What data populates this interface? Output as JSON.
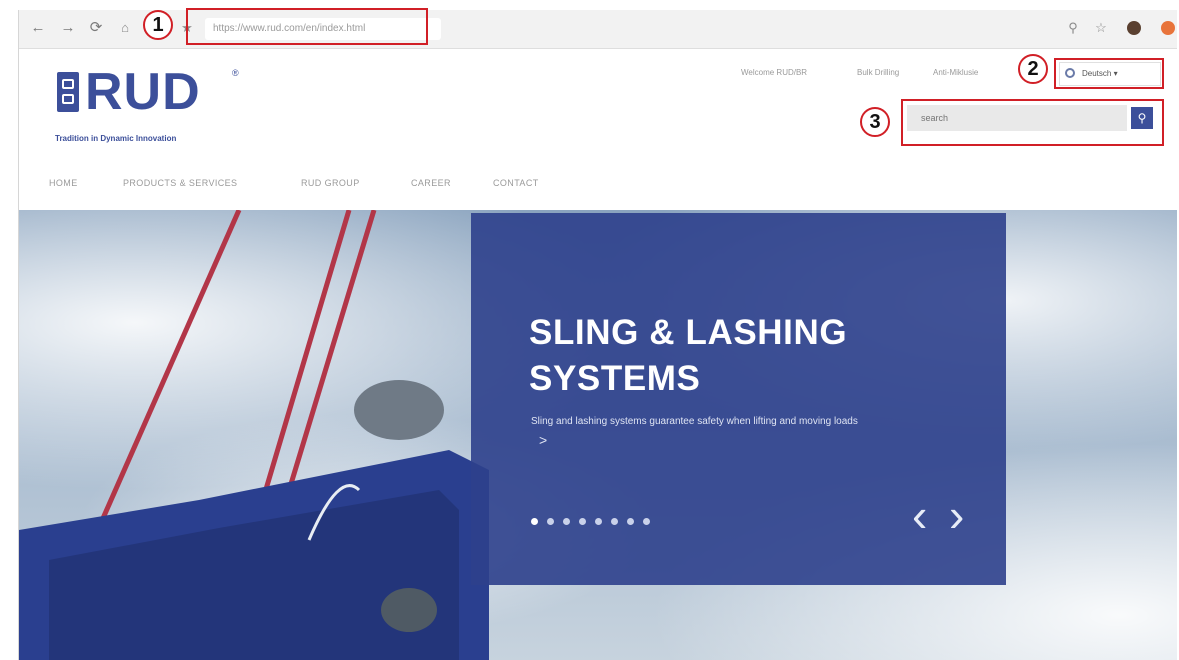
{
  "browser": {
    "back_glyph": "←",
    "forward_glyph": "→",
    "reload_glyph": "⟳",
    "url": "https://www.rud.com/en/index.html"
  },
  "header": {
    "logo_text": "RUD",
    "logo_reg": "®",
    "tagline": "Tradition in Dynamic Innovation",
    "top_links": [
      "Welcome RUD/BR",
      "Bulk Drilling",
      "Anti-Miklusie"
    ],
    "language_label": "Deutsch",
    "search_placeholder": "search"
  },
  "nav": {
    "items": [
      "HOME",
      "PRODUCTS & SERVICES",
      "RUD GROUP",
      "CAREER",
      "CONTACT"
    ]
  },
  "hero": {
    "headline_line1": "SLING & LASHING",
    "headline_line2": "SYSTEMS",
    "subtext": "Sling and lashing systems guarantee safety when lifting and moving loads",
    "subtext_arrow": ">",
    "slide_count": 8,
    "active_slide": 1,
    "prev_arrow": "‹",
    "next_arrow": "›"
  },
  "annotations": {
    "one": "1",
    "two": "2",
    "three": "3"
  },
  "colors": {
    "brand_blue": "#3c4f9a",
    "annotation_red": "#d11f26"
  },
  "icons": {
    "search_button": "search-icon",
    "language": "globe-icon"
  }
}
